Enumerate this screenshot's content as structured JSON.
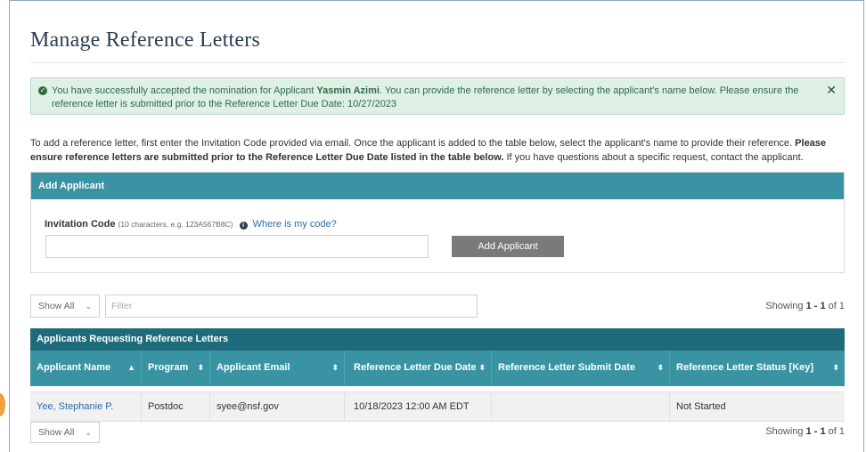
{
  "page": {
    "title": "Manage Reference Letters"
  },
  "alert": {
    "prefix": "You have successfully accepted the nomination for Applicant ",
    "applicant": "Yasmin Azimi",
    "line1_suffix": ". You can provide the reference letter by selecting the applicant's name below. Please ensure the",
    "line2": "reference letter is submitted prior to the Reference Letter Due Date: 10/27/2023",
    "close_label": "✕"
  },
  "intro": {
    "text1": "To add a reference letter, first enter the Invitation Code provided via email. Once the applicant is added to the table below, select the applicant's name to provide their reference. ",
    "bold1": "Please ensure reference letters are submitted prior to the Reference Letter Due Date listed in the table below.",
    "text2": " If you have questions about a specific request, contact the applicant."
  },
  "add_applicant": {
    "header": "Add Applicant",
    "label": "Invitation Code",
    "hint": "(10 characters, e.g. 123A567B8C)",
    "help_link": "Where is my code?",
    "input_value": "",
    "button_label": "Add Applicant"
  },
  "toolbar_top": {
    "show_select": "Show All",
    "filter_placeholder": "Filter",
    "showing_prefix": "Showing ",
    "showing_range": "1 - 1",
    "showing_suffix": " of 1"
  },
  "table": {
    "title": "Applicants Requesting Reference Letters",
    "columns": [
      "Applicant Name",
      "Program",
      "Applicant Email",
      "Reference Letter Due Date",
      "Reference Letter Submit Date",
      "Reference Letter Status [Key]"
    ],
    "sort_icons": [
      "▲",
      "⬍",
      "⬍",
      "⬍",
      "⬍",
      "⬍"
    ],
    "rows": [
      [
        "Yee, Stephanie P.",
        "Postdoc",
        "syee@nsf.gov",
        "10/18/2023 12:00 AM EDT",
        "",
        "Not Started"
      ]
    ]
  },
  "toolbar_bottom": {
    "show_select": "Show All",
    "showing_prefix": "Showing ",
    "showing_range": "1 - 1",
    "showing_suffix": " of 1"
  },
  "colors": {
    "panel_header": "#3a93a3",
    "table_title": "#1e6b7b",
    "alert_bg": "#dff0e6",
    "link": "#2a6bb0"
  }
}
